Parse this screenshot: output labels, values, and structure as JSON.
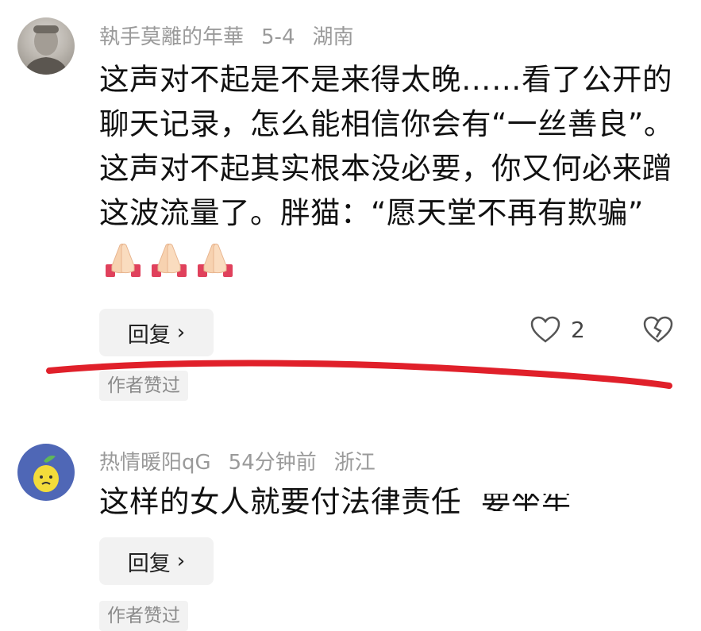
{
  "comments": [
    {
      "username": "執手莫離的年華",
      "time": "5-4",
      "location": "湖南",
      "text": "这声对不起是不是来得太晚……看了公开的聊天记录，怎么能相信你会有“一丝善良”。这声对不起其实根本没必要，你又何必来蹭这波流量了。胖猫：“愿天堂不再有欺骗”",
      "reply_label": "回复",
      "likes": "2",
      "badge": "作者赞过",
      "emoji": [
        "folded-hands-icon",
        "folded-hands-icon",
        "folded-hands-icon"
      ]
    },
    {
      "username": "热情暖阳qG",
      "time": "54分钟前",
      "location": "浙江",
      "text": "这样的女人就要付法律责任",
      "text_cut": "要坐牢",
      "reply_label": "回复",
      "badge": "作者赞过"
    }
  ],
  "colors": {
    "annotation_red": "#e0202a",
    "meta_gray": "#9a9a9a",
    "button_bg": "#f2f2f2"
  }
}
